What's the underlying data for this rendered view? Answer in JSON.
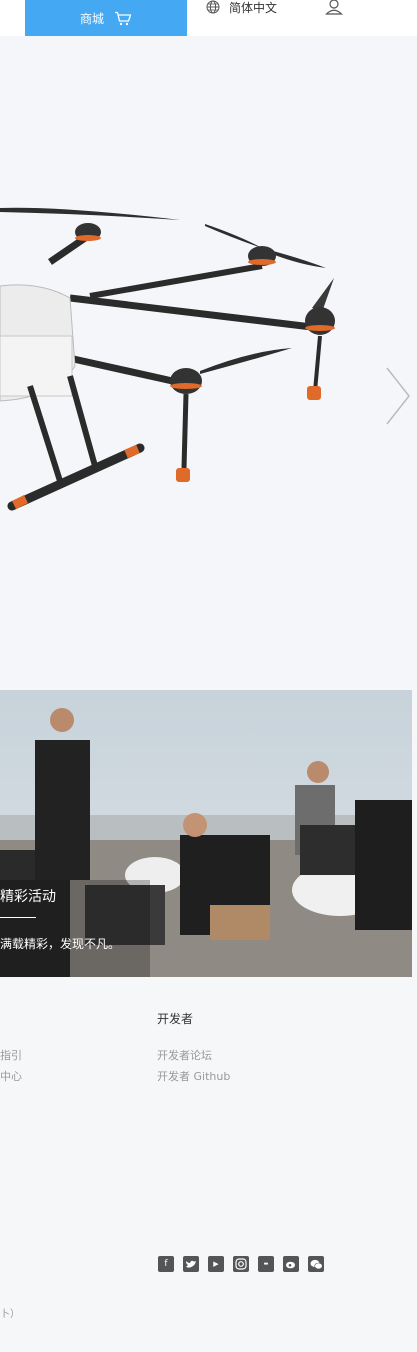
{
  "header": {
    "store_label": "商城",
    "language_label": "简体中文"
  },
  "event": {
    "title": "精彩活动",
    "subtitle": "满载精彩，发现不凡。"
  },
  "footer": {
    "left_links": [
      "指引",
      "中心"
    ],
    "developer": {
      "heading": "开发者",
      "links": [
        "开发者论坛",
        "开发者 Github"
      ]
    },
    "social_icons": [
      "facebook-icon",
      "twitter-icon",
      "youtube-icon",
      "instagram-icon",
      "youku-icon",
      "weibo-icon",
      "wechat-icon"
    ],
    "copyright_fragment": "卜）"
  },
  "colors": {
    "accent": "#44a8f2",
    "background": "#f6f7f9"
  }
}
